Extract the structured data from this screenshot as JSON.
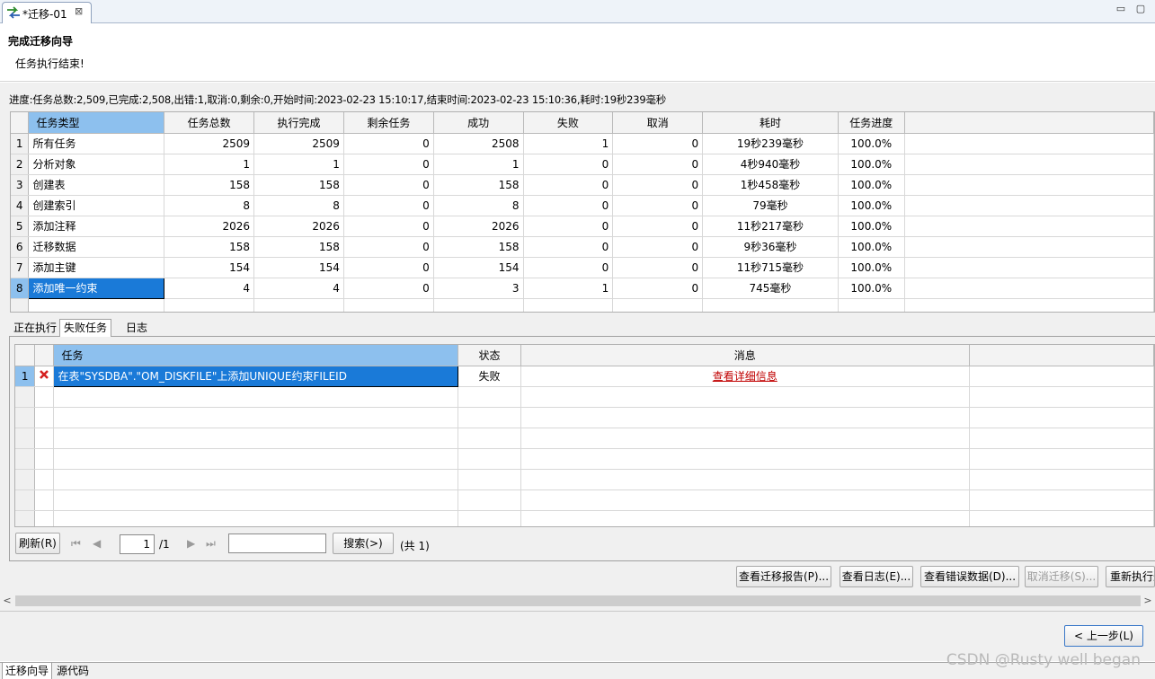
{
  "editor_tab": {
    "label": "*迁移-01",
    "close": "⊠"
  },
  "window_controls": {
    "minimize": "▭",
    "maximize": "▢"
  },
  "wizard": {
    "title": "完成迁移向导",
    "subtitle": "任务执行结束!"
  },
  "progress_text": "进度:任务总数:2,509,已完成:2,508,出错:1,取消:0,剩余:0,开始时间:2023-02-23 15:10:17,结束时间:2023-02-23 15:10:36,耗时:19秒239毫秒",
  "main_table": {
    "headers": [
      "任务类型",
      "任务总数",
      "执行完成",
      "剩余任务",
      "成功",
      "失败",
      "取消",
      "耗时",
      "任务进度"
    ],
    "rows": [
      {
        "n": "1",
        "type": "所有任务",
        "total": "2509",
        "done": "2509",
        "remain": "0",
        "ok": "2508",
        "fail": "1",
        "cancel": "0",
        "time": "19秒239毫秒",
        "pct": "100.0%"
      },
      {
        "n": "2",
        "type": "分析对象",
        "total": "1",
        "done": "1",
        "remain": "0",
        "ok": "1",
        "fail": "0",
        "cancel": "0",
        "time": "4秒940毫秒",
        "pct": "100.0%"
      },
      {
        "n": "3",
        "type": "创建表",
        "total": "158",
        "done": "158",
        "remain": "0",
        "ok": "158",
        "fail": "0",
        "cancel": "0",
        "time": "1秒458毫秒",
        "pct": "100.0%"
      },
      {
        "n": "4",
        "type": "创建索引",
        "total": "8",
        "done": "8",
        "remain": "0",
        "ok": "8",
        "fail": "0",
        "cancel": "0",
        "time": "79毫秒",
        "pct": "100.0%"
      },
      {
        "n": "5",
        "type": "添加注释",
        "total": "2026",
        "done": "2026",
        "remain": "0",
        "ok": "2026",
        "fail": "0",
        "cancel": "0",
        "time": "11秒217毫秒",
        "pct": "100.0%"
      },
      {
        "n": "6",
        "type": "迁移数据",
        "total": "158",
        "done": "158",
        "remain": "0",
        "ok": "158",
        "fail": "0",
        "cancel": "0",
        "time": "9秒36毫秒",
        "pct": "100.0%"
      },
      {
        "n": "7",
        "type": "添加主键",
        "total": "154",
        "done": "154",
        "remain": "0",
        "ok": "154",
        "fail": "0",
        "cancel": "0",
        "time": "11秒715毫秒",
        "pct": "100.0%"
      },
      {
        "n": "8",
        "type": "添加唯一约束",
        "total": "4",
        "done": "4",
        "remain": "0",
        "ok": "3",
        "fail": "1",
        "cancel": "0",
        "time": "745毫秒",
        "pct": "100.0%"
      }
    ]
  },
  "sub_tabs": [
    "正在执行",
    "失败任务",
    "日志"
  ],
  "fail_table": {
    "headers": [
      "任务",
      "状态",
      "消息"
    ],
    "rows": [
      {
        "n": "1",
        "task": "在表\"SYSDBA\".\"OM_DISKFILE\"上添加UNIQUE约束FILEID",
        "status": "失败",
        "message": "查看详细信息"
      }
    ]
  },
  "pager": {
    "refresh": "刷新(R)",
    "first": "⏮",
    "prev": "◀",
    "page": "1",
    "page_total": "/1",
    "next": "▶",
    "last": "⏭",
    "search_value": "",
    "search": "搜索(>)",
    "count": "(共 1)"
  },
  "actions": {
    "report": "查看迁移报告(P)...",
    "log": "查看日志(E)...",
    "error_data": "查看错误数据(D)...",
    "cancel": "取消迁移(S)...",
    "rerun": "重新执行迁移"
  },
  "back_button": "< 上一步(L)",
  "bottom_tabs": [
    "迁移向导",
    "源代码"
  ],
  "watermark": "CSDN @Rusty well began",
  "colors": {
    "selection": "#1a7ad8",
    "header_selected": "#8dc0ee",
    "error_red": "#c00000"
  }
}
